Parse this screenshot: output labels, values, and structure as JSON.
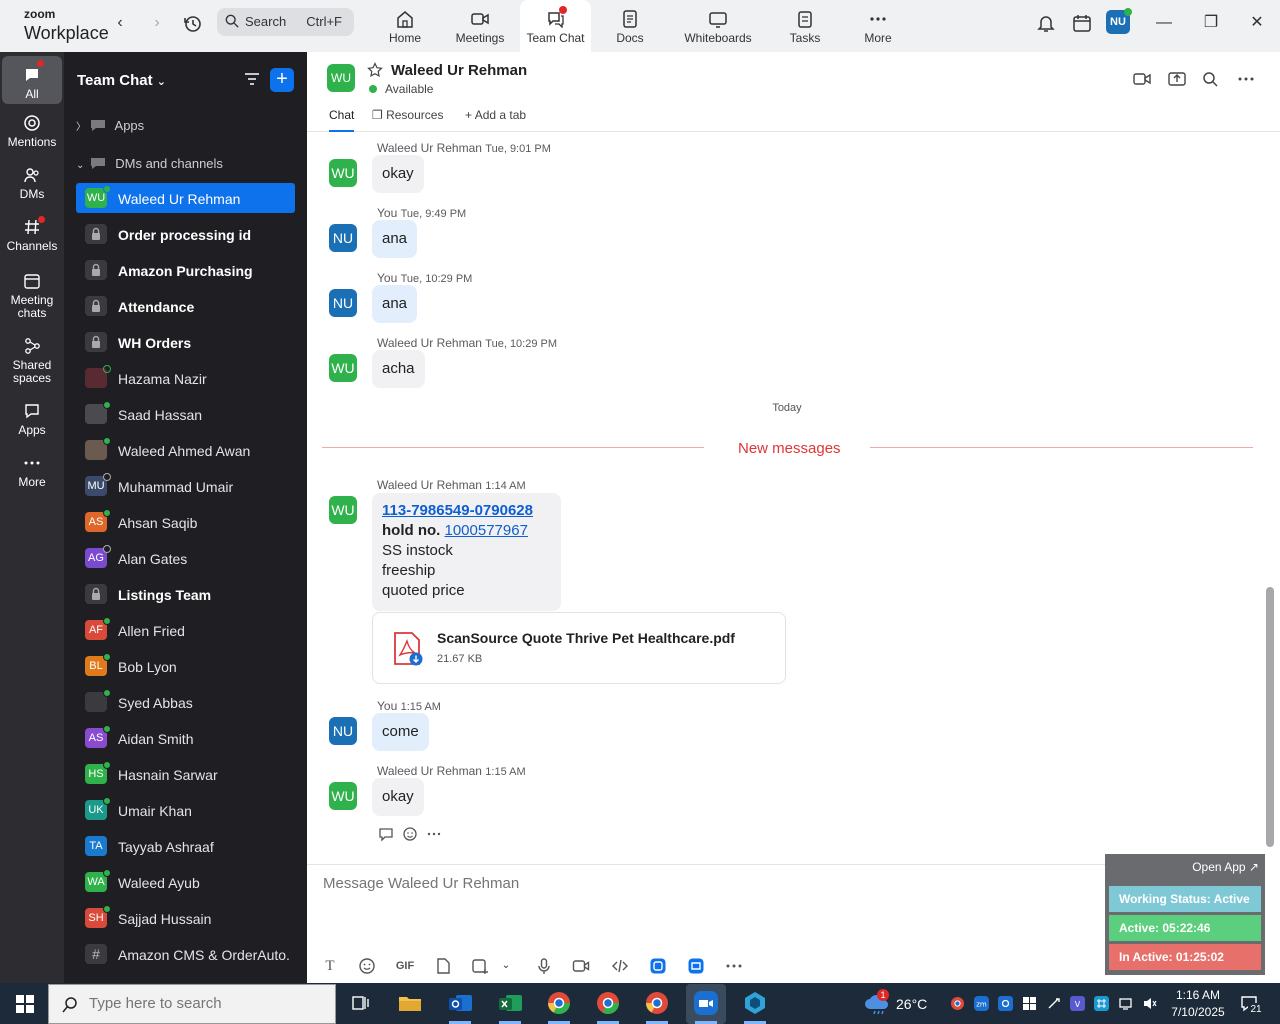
{
  "app": {
    "brand_small": "zoom",
    "brand_big": "Workplace",
    "search_label": "Search",
    "search_shortcut": "Ctrl+F",
    "user_initials": "NU"
  },
  "nav_tabs": [
    {
      "label": "Home"
    },
    {
      "label": "Meetings"
    },
    {
      "label": "Team Chat"
    },
    {
      "label": "Docs"
    },
    {
      "label": "Whiteboards"
    },
    {
      "label": "Tasks"
    },
    {
      "label": "More"
    }
  ],
  "rail": [
    {
      "label": "All"
    },
    {
      "label": "Mentions"
    },
    {
      "label": "DMs"
    },
    {
      "label": "Channels"
    },
    {
      "label": "Meeting chats"
    },
    {
      "label": "Shared spaces"
    },
    {
      "label": "Apps"
    },
    {
      "label": "More"
    }
  ],
  "channel_list": {
    "title": "Team Chat",
    "section_apps": "Apps",
    "section_dms": "DMs and channels",
    "items": [
      {
        "name": "Waleed Ur Rehman",
        "initials": "WU",
        "color": "#2fb24c"
      },
      {
        "name": "Order processing id",
        "initials": "",
        "color": "#3a3a3f"
      },
      {
        "name": "Amazon Purchasing",
        "initials": "",
        "color": "#3a3a3f"
      },
      {
        "name": "Attendance",
        "initials": "",
        "color": "#3a3a3f"
      },
      {
        "name": "WH Orders",
        "initials": "",
        "color": "#3a3a3f"
      },
      {
        "name": "Hazama Nazir",
        "initials": "",
        "color": "#5a2a33"
      },
      {
        "name": "Saad Hassan",
        "initials": "",
        "color": "#4a4a50"
      },
      {
        "name": "Waleed Ahmed Awan",
        "initials": "",
        "color": "#6b5a50"
      },
      {
        "name": "Muhammad Umair",
        "initials": "MU",
        "color": "#3a4a6a"
      },
      {
        "name": "Ahsan Saqib",
        "initials": "AS",
        "color": "#e0672a"
      },
      {
        "name": "Alan Gates",
        "initials": "AG",
        "color": "#7a4bd0"
      },
      {
        "name": "Listings Team",
        "initials": "",
        "color": "#3a3a3f"
      },
      {
        "name": "Allen Fried",
        "initials": "AF",
        "color": "#d94a3a"
      },
      {
        "name": "Bob Lyon",
        "initials": "BL",
        "color": "#e07a1a"
      },
      {
        "name": "Syed Abbas",
        "initials": "",
        "color": "#3a3a3f"
      },
      {
        "name": "Aidan Smith",
        "initials": "AS",
        "color": "#8a4bd0"
      },
      {
        "name": "Hasnain Sarwar",
        "initials": "HS",
        "color": "#2fb24c"
      },
      {
        "name": "Umair Khan",
        "initials": "UK",
        "color": "#1a9a8a"
      },
      {
        "name": "Tayyab Ashraaf",
        "initials": "TA",
        "color": "#1a7ad0"
      },
      {
        "name": "Waleed Ayub",
        "initials": "WA",
        "color": "#2fb24c"
      },
      {
        "name": "Sajjad Hussain",
        "initials": "SH",
        "color": "#d94a3a"
      },
      {
        "name": "Amazon CMS & OrderAuto...",
        "initials": "#",
        "color": "#3a3a3f"
      }
    ]
  },
  "chat_header": {
    "initials": "WU",
    "name": "Waleed Ur Rehman",
    "status": "Available",
    "tabs": [
      {
        "label": "Chat"
      },
      {
        "label": "Resources"
      },
      {
        "label": "Add a tab"
      }
    ]
  },
  "messages": {
    "day_label": "Today",
    "new_label": "New messages",
    "list": [
      {
        "initials": "WU",
        "sender": "Waleed Ur Rehman",
        "time": "Tue, 9:01 PM",
        "text": "okay"
      },
      {
        "initials": "NU",
        "sender": "You",
        "time": "Tue, 9:49 PM",
        "text": "ana"
      },
      {
        "initials": "NU",
        "sender": "You",
        "time": "Tue, 10:29 PM",
        "text": "ana"
      },
      {
        "initials": "WU",
        "sender": "Waleed Ur Rehman",
        "time": "Tue, 10:29 PM",
        "text": "acha"
      },
      {
        "initials": "WU",
        "sender": "Waleed Ur Rehman",
        "time": "1:14 AM",
        "text": ""
      },
      {
        "initials": "NU",
        "sender": "You",
        "time": "1:15 AM",
        "text": "come"
      },
      {
        "initials": "WU",
        "sender": "Waleed Ur Rehman",
        "time": "1:15 AM",
        "text": "okay"
      }
    ],
    "rich": {
      "order_link": "113-7986549-0790628",
      "hold_label": "hold no.",
      "hold_link": "1000577967",
      "line1": "SS instock",
      "line2": "freeship",
      "line3": "quoted price"
    },
    "file": {
      "name": "ScanSource Quote Thrive Pet Healthcare.pdf",
      "size": "21.67 KB"
    }
  },
  "composer": {
    "placeholder": "Message Waleed Ur Rehman",
    "gif_label": "GIF"
  },
  "working_status": {
    "open_app": "Open App ↗",
    "status": "Working Status: Active",
    "active": "Active: 05:22:46",
    "inactive": "In Active: 01:25:02"
  },
  "taskbar": {
    "search_placeholder": "Type here to search",
    "temperature": "26°C",
    "time": "1:16 AM",
    "date": "7/10/2025",
    "notif_count": "21",
    "weather_badge": "1"
  }
}
